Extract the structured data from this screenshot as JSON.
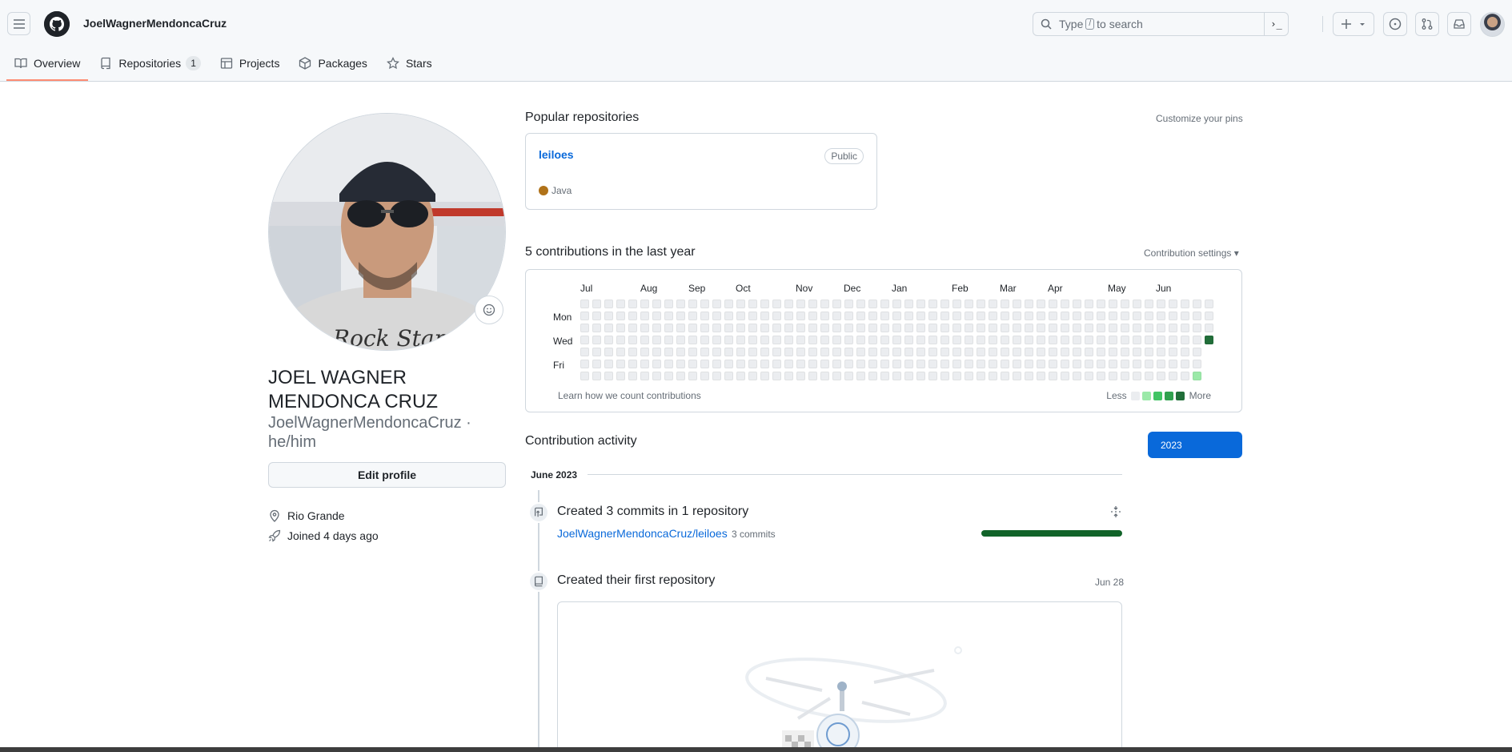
{
  "header": {
    "username": "JoelWagnerMendoncaCruz",
    "search_prefix": "Type",
    "search_key": "/",
    "search_suffix": "to search",
    "cmd_label": "›_"
  },
  "tabs": [
    {
      "label": "Overview",
      "icon": "book-icon",
      "active": true
    },
    {
      "label": "Repositories",
      "icon": "repo-icon",
      "count": "1"
    },
    {
      "label": "Projects",
      "icon": "table-icon"
    },
    {
      "label": "Packages",
      "icon": "package-icon"
    },
    {
      "label": "Stars",
      "icon": "star-icon"
    }
  ],
  "profile": {
    "fullname_line1": "JOEL WAGNER",
    "fullname_line2": "MENDONCA CRUZ",
    "login_line1": "JoelWagnerMendoncaCruz ·",
    "login_line2": "he/him",
    "edit_label": "Edit profile",
    "location": "Rio Grande",
    "joined": "Joined 4 days ago"
  },
  "pinned": {
    "title": "Popular repositories",
    "customize": "Customize your pins",
    "repo": {
      "name": "leiloes",
      "visibility": "Public",
      "language": "Java",
      "language_color": "#b07219"
    }
  },
  "contributions": {
    "title": "5 contributions in the last year",
    "settings": "Contribution settings",
    "months": [
      "Jul",
      "Aug",
      "Sep",
      "Oct",
      "Nov",
      "Dec",
      "Jan",
      "Feb",
      "Mar",
      "Apr",
      "May",
      "Jun"
    ],
    "days": [
      "Mon",
      "Wed",
      "Fri"
    ],
    "learn": "Learn how we count contributions",
    "less": "Less",
    "more": "More",
    "colors": [
      "#ebedf0",
      "#9be9a8",
      "#40c463",
      "#30a14e",
      "#216e39"
    ]
  },
  "activity": {
    "title": "Contribution activity",
    "year": "2023",
    "month": "June 2023",
    "commits_title": "Created 3 commits in 1 repository",
    "commits_repo": "JoelWagnerMendoncaCruz/leiloes",
    "commits_count": "3 commits",
    "first_repo_title": "Created their first repository",
    "first_repo_date": "Jun 28"
  }
}
